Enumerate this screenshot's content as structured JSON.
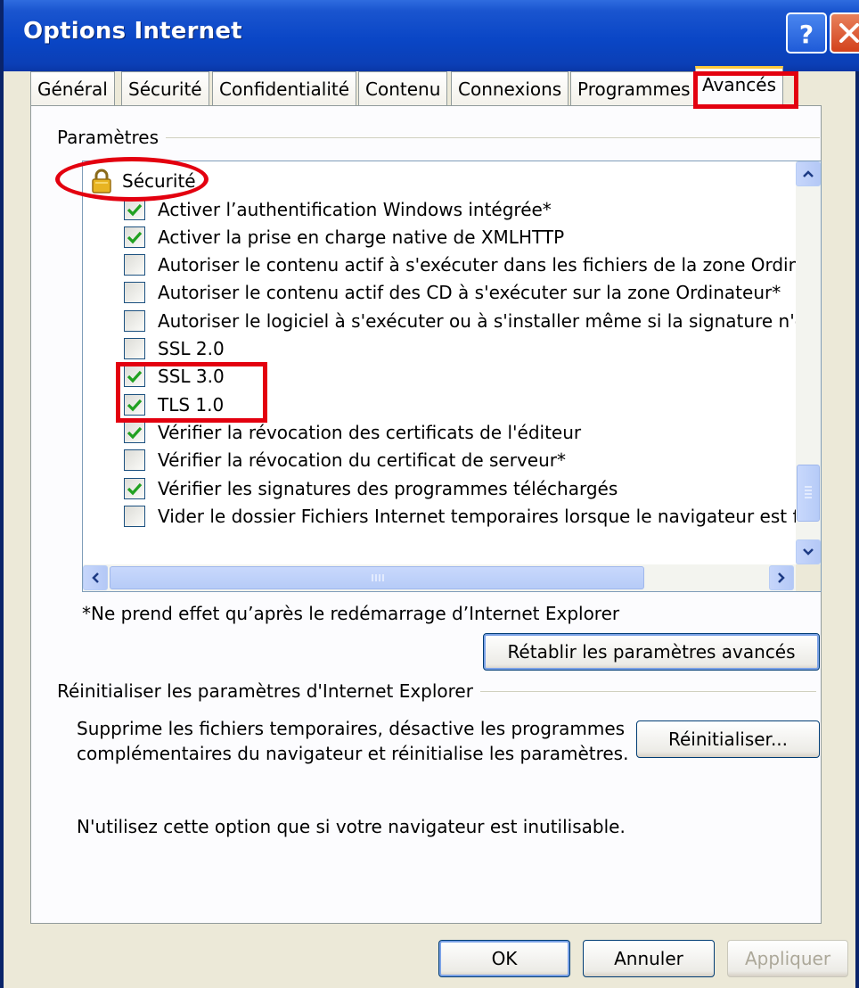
{
  "window": {
    "title": "Options Internet"
  },
  "titlebar": {
    "help_icon": "help-icon",
    "close_icon": "close-icon"
  },
  "tabs": [
    {
      "label": "Général"
    },
    {
      "label": "Sécurité"
    },
    {
      "label": "Confidentialité"
    },
    {
      "label": "Contenu"
    },
    {
      "label": "Connexions"
    },
    {
      "label": "Programmes"
    },
    {
      "label": "Avancés",
      "active": true
    }
  ],
  "settings": {
    "group_label": "Paramètres",
    "category": {
      "label": "Sécurité",
      "icon": "lock-icon"
    },
    "items": [
      {
        "label": "Activer l’authentification Windows intégrée*",
        "checked": true
      },
      {
        "label": "Activer la prise en charge native de XMLHTTP",
        "checked": true
      },
      {
        "label": "Autoriser le contenu actif à s'exécuter dans les fichiers de la zone Ordinate",
        "checked": false
      },
      {
        "label": "Autoriser le contenu actif des CD à s'exécuter sur la zone Ordinateur*",
        "checked": false
      },
      {
        "label": "Autoriser le logiciel à s'exécuter ou à s'installer même si la signature n'est p",
        "checked": false
      },
      {
        "label": "SSL 2.0",
        "checked": false
      },
      {
        "label": "SSL 3.0",
        "checked": true
      },
      {
        "label": "TLS 1.0",
        "checked": true
      },
      {
        "label": "Vérifier la révocation des certificats de l'éditeur",
        "checked": true
      },
      {
        "label": "Vérifier la révocation du certificat de serveur*",
        "checked": false
      },
      {
        "label": "Vérifier les signatures des programmes téléchargés",
        "checked": true
      },
      {
        "label": "Vider le dossier Fichiers Internet temporaires lorsque le navigateur est ferr",
        "checked": false
      }
    ],
    "footnote": "*Ne prend effet qu’après le redémarrage d’Internet Explorer",
    "restore_button": "Rétablir les paramètres avancés"
  },
  "reset": {
    "group_label": "Réinitialiser les paramètres d'Internet Explorer",
    "description_line1": "Supprime les fichiers temporaires, désactive les programmes",
    "description_line2": "complémentaires du navigateur et réinitialise les paramètres.",
    "button": "Réinitialiser...",
    "note": "N'utilisez cette option que si votre navigateur est inutilisable."
  },
  "footer": {
    "ok": "OK",
    "cancel": "Annuler",
    "apply": "Appliquer",
    "apply_disabled": true
  },
  "colors": {
    "titlebar": "#0a46c6",
    "highlight": "#e3000f",
    "check": "#21a121"
  }
}
